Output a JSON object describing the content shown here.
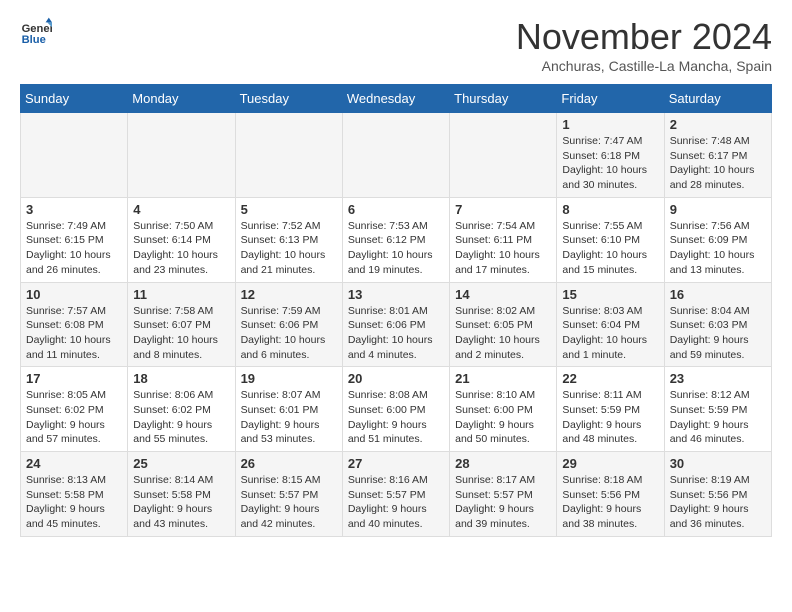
{
  "logo": {
    "general": "General",
    "blue": "Blue"
  },
  "header": {
    "month": "November 2024",
    "location": "Anchuras, Castille-La Mancha, Spain"
  },
  "weekdays": [
    "Sunday",
    "Monday",
    "Tuesday",
    "Wednesday",
    "Thursday",
    "Friday",
    "Saturday"
  ],
  "weeks": [
    [
      {
        "day": "",
        "info": ""
      },
      {
        "day": "",
        "info": ""
      },
      {
        "day": "",
        "info": ""
      },
      {
        "day": "",
        "info": ""
      },
      {
        "day": "",
        "info": ""
      },
      {
        "day": "1",
        "info": "Sunrise: 7:47 AM\nSunset: 6:18 PM\nDaylight: 10 hours\nand 30 minutes."
      },
      {
        "day": "2",
        "info": "Sunrise: 7:48 AM\nSunset: 6:17 PM\nDaylight: 10 hours\nand 28 minutes."
      }
    ],
    [
      {
        "day": "3",
        "info": "Sunrise: 7:49 AM\nSunset: 6:15 PM\nDaylight: 10 hours\nand 26 minutes."
      },
      {
        "day": "4",
        "info": "Sunrise: 7:50 AM\nSunset: 6:14 PM\nDaylight: 10 hours\nand 23 minutes."
      },
      {
        "day": "5",
        "info": "Sunrise: 7:52 AM\nSunset: 6:13 PM\nDaylight: 10 hours\nand 21 minutes."
      },
      {
        "day": "6",
        "info": "Sunrise: 7:53 AM\nSunset: 6:12 PM\nDaylight: 10 hours\nand 19 minutes."
      },
      {
        "day": "7",
        "info": "Sunrise: 7:54 AM\nSunset: 6:11 PM\nDaylight: 10 hours\nand 17 minutes."
      },
      {
        "day": "8",
        "info": "Sunrise: 7:55 AM\nSunset: 6:10 PM\nDaylight: 10 hours\nand 15 minutes."
      },
      {
        "day": "9",
        "info": "Sunrise: 7:56 AM\nSunset: 6:09 PM\nDaylight: 10 hours\nand 13 minutes."
      }
    ],
    [
      {
        "day": "10",
        "info": "Sunrise: 7:57 AM\nSunset: 6:08 PM\nDaylight: 10 hours\nand 11 minutes."
      },
      {
        "day": "11",
        "info": "Sunrise: 7:58 AM\nSunset: 6:07 PM\nDaylight: 10 hours\nand 8 minutes."
      },
      {
        "day": "12",
        "info": "Sunrise: 7:59 AM\nSunset: 6:06 PM\nDaylight: 10 hours\nand 6 minutes."
      },
      {
        "day": "13",
        "info": "Sunrise: 8:01 AM\nSunset: 6:06 PM\nDaylight: 10 hours\nand 4 minutes."
      },
      {
        "day": "14",
        "info": "Sunrise: 8:02 AM\nSunset: 6:05 PM\nDaylight: 10 hours\nand 2 minutes."
      },
      {
        "day": "15",
        "info": "Sunrise: 8:03 AM\nSunset: 6:04 PM\nDaylight: 10 hours\nand 1 minute."
      },
      {
        "day": "16",
        "info": "Sunrise: 8:04 AM\nSunset: 6:03 PM\nDaylight: 9 hours\nand 59 minutes."
      }
    ],
    [
      {
        "day": "17",
        "info": "Sunrise: 8:05 AM\nSunset: 6:02 PM\nDaylight: 9 hours\nand 57 minutes."
      },
      {
        "day": "18",
        "info": "Sunrise: 8:06 AM\nSunset: 6:02 PM\nDaylight: 9 hours\nand 55 minutes."
      },
      {
        "day": "19",
        "info": "Sunrise: 8:07 AM\nSunset: 6:01 PM\nDaylight: 9 hours\nand 53 minutes."
      },
      {
        "day": "20",
        "info": "Sunrise: 8:08 AM\nSunset: 6:00 PM\nDaylight: 9 hours\nand 51 minutes."
      },
      {
        "day": "21",
        "info": "Sunrise: 8:10 AM\nSunset: 6:00 PM\nDaylight: 9 hours\nand 50 minutes."
      },
      {
        "day": "22",
        "info": "Sunrise: 8:11 AM\nSunset: 5:59 PM\nDaylight: 9 hours\nand 48 minutes."
      },
      {
        "day": "23",
        "info": "Sunrise: 8:12 AM\nSunset: 5:59 PM\nDaylight: 9 hours\nand 46 minutes."
      }
    ],
    [
      {
        "day": "24",
        "info": "Sunrise: 8:13 AM\nSunset: 5:58 PM\nDaylight: 9 hours\nand 45 minutes."
      },
      {
        "day": "25",
        "info": "Sunrise: 8:14 AM\nSunset: 5:58 PM\nDaylight: 9 hours\nand 43 minutes."
      },
      {
        "day": "26",
        "info": "Sunrise: 8:15 AM\nSunset: 5:57 PM\nDaylight: 9 hours\nand 42 minutes."
      },
      {
        "day": "27",
        "info": "Sunrise: 8:16 AM\nSunset: 5:57 PM\nDaylight: 9 hours\nand 40 minutes."
      },
      {
        "day": "28",
        "info": "Sunrise: 8:17 AM\nSunset: 5:57 PM\nDaylight: 9 hours\nand 39 minutes."
      },
      {
        "day": "29",
        "info": "Sunrise: 8:18 AM\nSunset: 5:56 PM\nDaylight: 9 hours\nand 38 minutes."
      },
      {
        "day": "30",
        "info": "Sunrise: 8:19 AM\nSunset: 5:56 PM\nDaylight: 9 hours\nand 36 minutes."
      }
    ]
  ]
}
